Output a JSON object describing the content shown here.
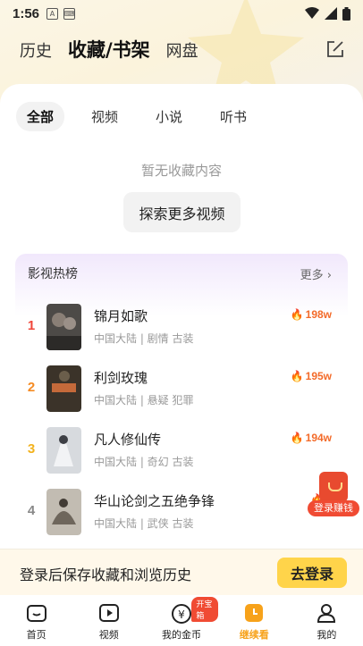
{
  "status_bar": {
    "time": "1:56"
  },
  "header": {
    "tabs": [
      {
        "label": "历史",
        "active": false
      },
      {
        "label": "收藏/书架",
        "active": true
      },
      {
        "label": "网盘",
        "active": false
      }
    ]
  },
  "subtabs": [
    {
      "label": "全部",
      "active": true
    },
    {
      "label": "视频",
      "active": false
    },
    {
      "label": "小说",
      "active": false
    },
    {
      "label": "听书",
      "active": false
    }
  ],
  "empty_state": {
    "message": "暂无收藏内容",
    "button": "探索更多视频"
  },
  "ranking": {
    "title": "影视热榜",
    "more": "更多",
    "items": [
      {
        "rank": "1",
        "title": "锦月如歌",
        "meta": "中国大陆 | 剧情 古装",
        "heat": "198w",
        "rank_color": "#f0463a",
        "poster_color": "#5a5550"
      },
      {
        "rank": "2",
        "title": "利剑玫瑰",
        "meta": "中国大陆 | 悬疑 犯罪",
        "heat": "195w",
        "rank_color": "#f58b23",
        "poster_color": "#3a3428"
      },
      {
        "rank": "3",
        "title": "凡人修仙传",
        "meta": "中国大陆 | 奇幻 古装",
        "heat": "194w",
        "rank_color": "#f2b21d",
        "poster_color": "#c9ccd2"
      },
      {
        "rank": "4",
        "title": "华山论剑之五绝争锋",
        "meta": "中国大陆 | 武侠 古装",
        "heat": "1",
        "rank_color": "#888888",
        "poster_color": "#b0aaa0"
      }
    ]
  },
  "float_reward": {
    "label": "登录赚钱"
  },
  "login_bar": {
    "text": "登录后保存收藏和浏览历史",
    "button": "去登录"
  },
  "bottom_nav": {
    "items": [
      {
        "label": "首页",
        "icon": "tv-icon",
        "active": false
      },
      {
        "label": "视频",
        "icon": "play-icon",
        "active": false
      },
      {
        "label": "我的金币",
        "icon": "coin-icon",
        "active": false,
        "badge": "开宝箱"
      },
      {
        "label": "继续看",
        "icon": "clock-icon",
        "active": true
      },
      {
        "label": "我的",
        "icon": "user-icon",
        "active": false
      }
    ]
  }
}
